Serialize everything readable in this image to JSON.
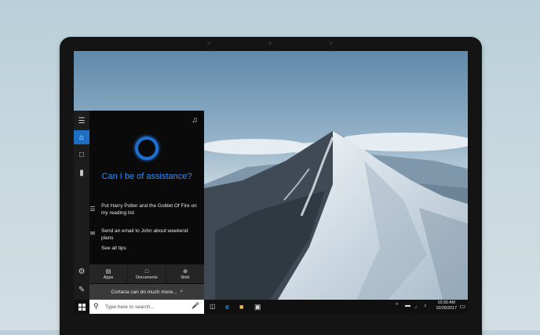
{
  "cortana": {
    "greeting": "Can I be of assistance?",
    "suggestions": [
      {
        "icon": "list-icon",
        "text": "Put Harry Potter and the Goblet Of Fire on my reading list"
      },
      {
        "icon": "mail-icon",
        "text": "Send an email to John about weekend plans"
      }
    ],
    "see_all_tips": "See all tips",
    "categories": [
      {
        "icon": "apps-icon",
        "label": "Apps"
      },
      {
        "icon": "documents-icon",
        "label": "Documents"
      },
      {
        "icon": "web-icon",
        "label": "Web"
      }
    ],
    "more_label": "Cortana can do much more...",
    "more_glyph": "^"
  },
  "taskbar": {
    "search_placeholder": "Type here to search...",
    "time": "10:30 AM",
    "date": "10/30/2017"
  },
  "colors": {
    "cortana_blue": "#2f8fff",
    "active_rail": "#1e6fc4",
    "panel_bg": "#0a0a0a",
    "taskbar_bg": "#101010"
  }
}
